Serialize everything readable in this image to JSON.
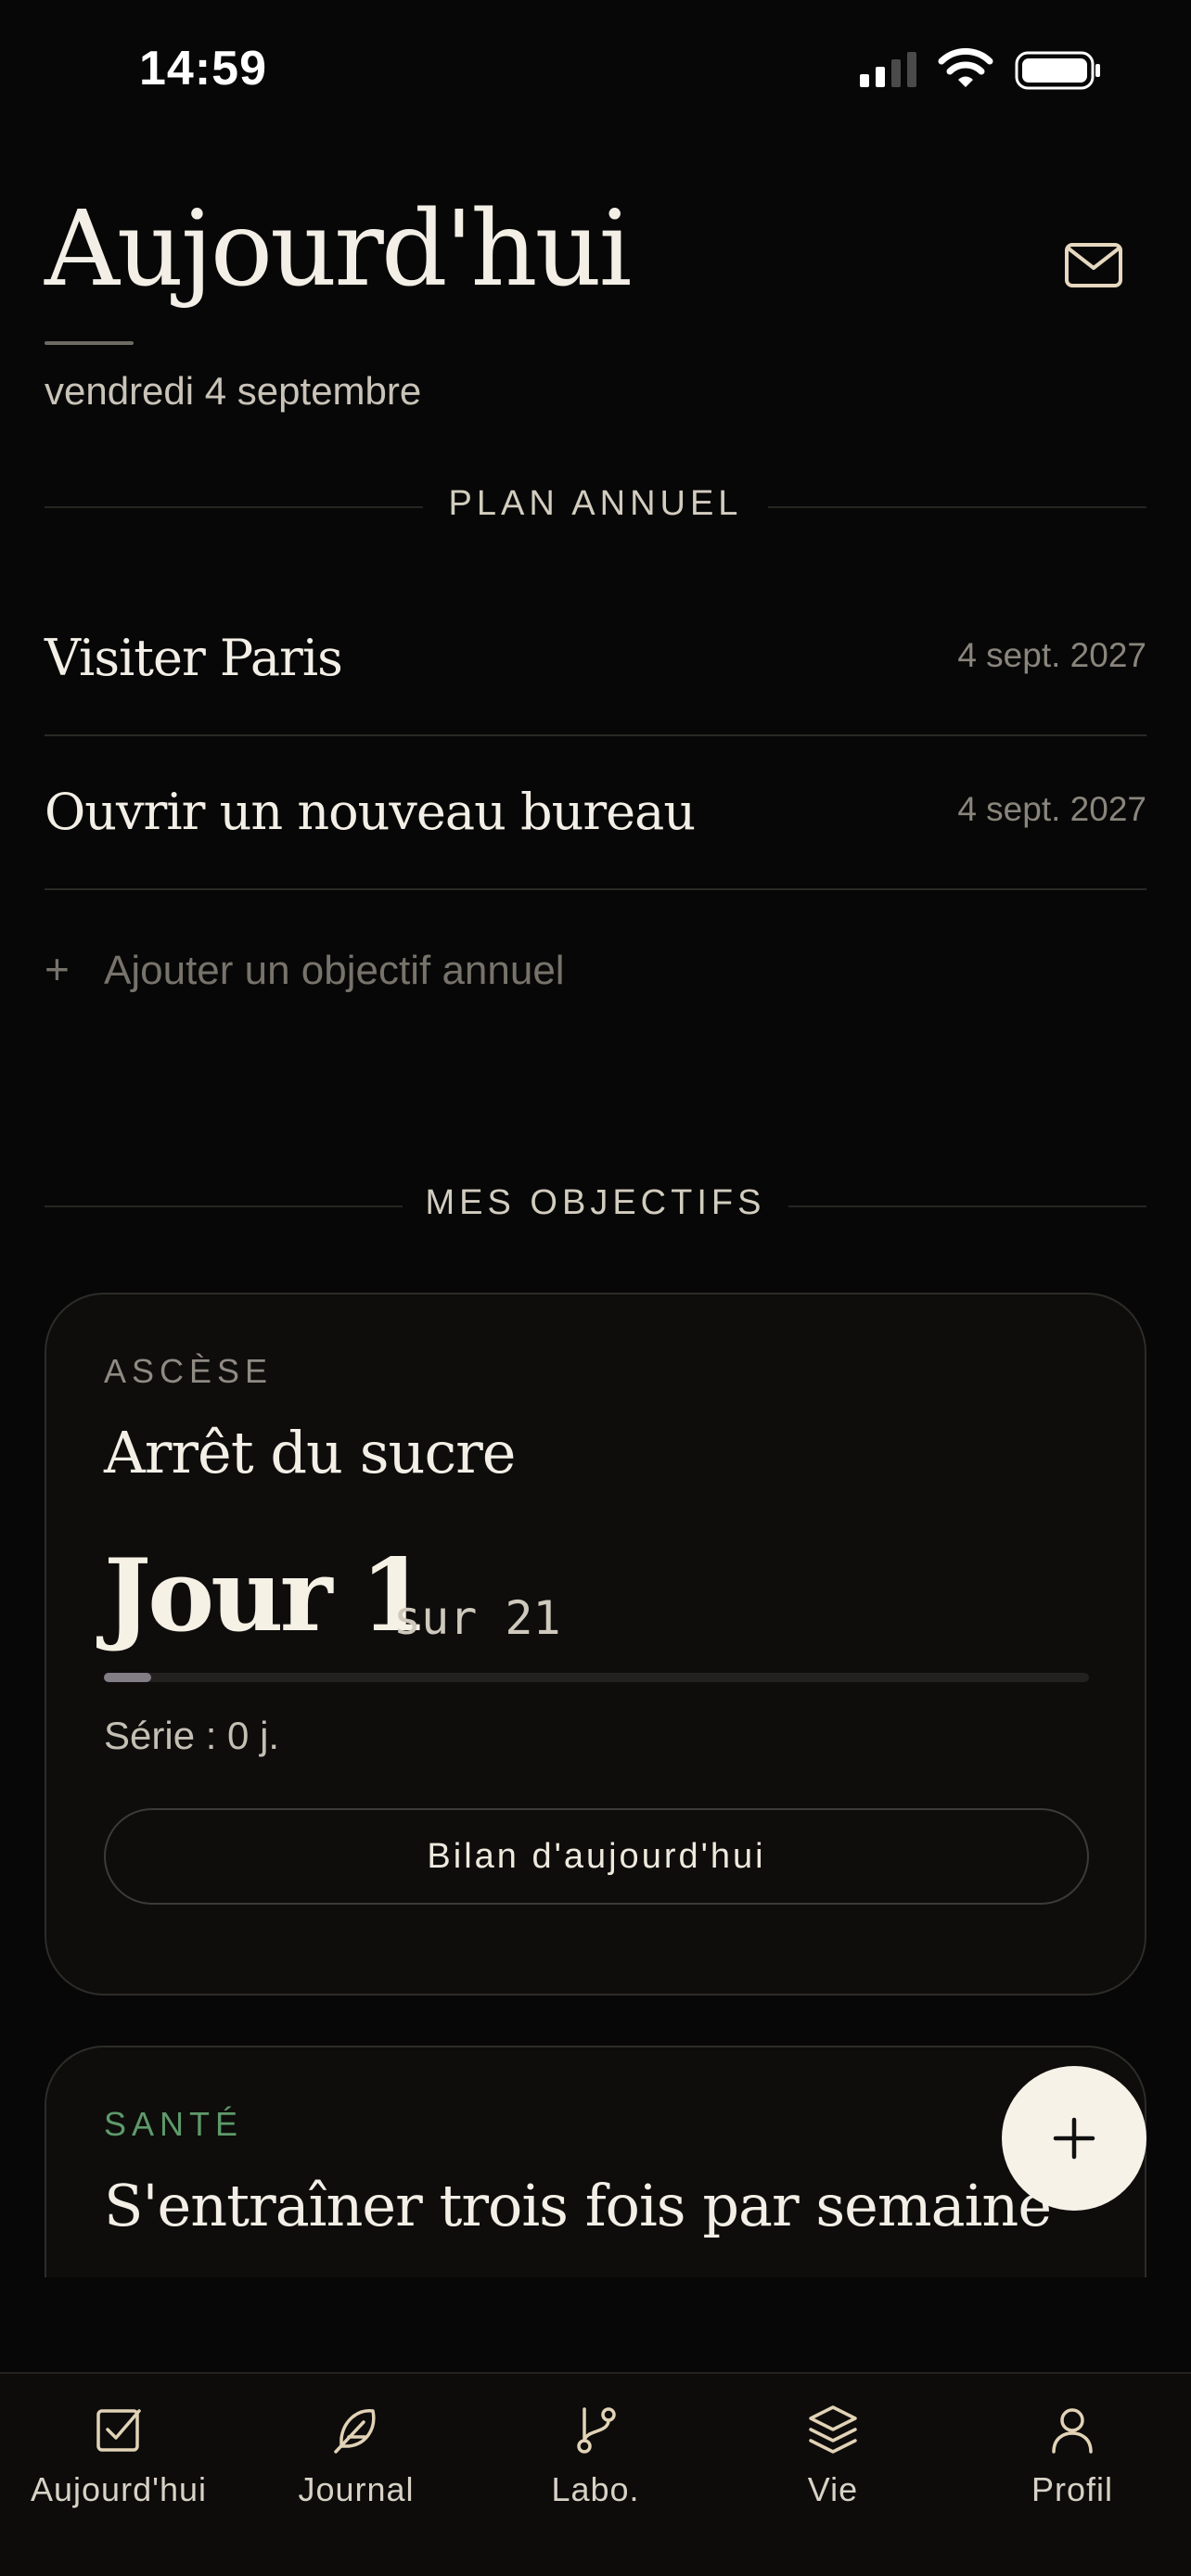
{
  "status_bar": {
    "time": "14:59"
  },
  "header": {
    "title": "Aujourd'hui",
    "date": "vendredi 4 septembre"
  },
  "annual_plan": {
    "section_label": "PLAN ANNUEL",
    "goals": [
      {
        "name": "Visiter Paris",
        "date": "4 sept. 2027"
      },
      {
        "name": "Ouvrir un nouveau bureau",
        "date": "4 sept. 2027"
      }
    ],
    "add_label": "Ajouter un objectif annuel"
  },
  "objectives": {
    "section_label": "MES OBJECTIFS",
    "cards": [
      {
        "category": "ASCÈSE",
        "category_color": "#8f8a82",
        "title": "Arrêt du sucre",
        "day_label": "Jour 1",
        "day_total": "sur 21",
        "progress": 0.0476,
        "streak": "Série : 0 j.",
        "button_label": "Bilan d'aujourd'hui"
      },
      {
        "category": "SANTÉ",
        "category_color": "#5e9a6a",
        "title": "S'entraîner trois fois par semaine"
      }
    ]
  },
  "tab_bar": {
    "tabs": [
      {
        "label": "Aujourd'hui",
        "icon": "checkbox-icon"
      },
      {
        "label": "Journal",
        "icon": "feather-icon"
      },
      {
        "label": "Labo.",
        "icon": "branch-icon"
      },
      {
        "label": "Vie",
        "icon": "layers-icon"
      },
      {
        "label": "Profil",
        "icon": "user-icon"
      }
    ]
  }
}
